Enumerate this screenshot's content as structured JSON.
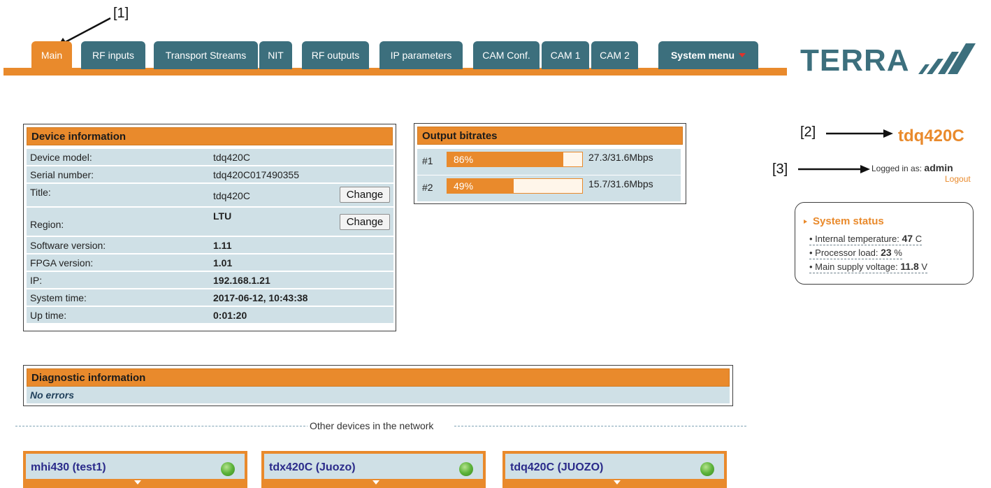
{
  "annotations": [
    "[1]",
    "[2]",
    "[3]"
  ],
  "tabs": [
    {
      "label": "Main",
      "active": true
    },
    {
      "label": "RF inputs",
      "active": false
    },
    {
      "label": "Transport Streams",
      "active": false
    },
    {
      "label": "NIT",
      "active": false
    },
    {
      "label": "RF outputs",
      "active": false
    },
    {
      "label": "IP parameters",
      "active": false
    },
    {
      "label": "CAM Conf.",
      "active": false
    },
    {
      "label": "CAM 1",
      "active": false
    },
    {
      "label": "CAM 2",
      "active": false
    },
    {
      "label": "System menu",
      "active": false
    }
  ],
  "logo": "TERRA",
  "device_info": {
    "title": "Device information",
    "rows": [
      {
        "label": "Device model:",
        "value": "tdq420C"
      },
      {
        "label": "Serial number:",
        "value": "tdq420C017490355"
      },
      {
        "label": "Title:",
        "value": "tdq420C",
        "button": "Change"
      },
      {
        "label": "Region:",
        "value": "LTU",
        "button": "Change"
      },
      {
        "label": "Software version:",
        "value": "1.11"
      },
      {
        "label": "FPGA version:",
        "value": "1.01"
      },
      {
        "label": "IP:",
        "value": "192.168.1.21"
      },
      {
        "label": "System time:",
        "value": "2017-06-12, 10:43:38"
      },
      {
        "label": "Up time:",
        "value": "0:01:20"
      }
    ]
  },
  "output_bitrates": {
    "title": "Output bitrates",
    "rows": [
      {
        "label": "#1",
        "percent": 86,
        "percent_label": "86%",
        "value": "27.3/31.6Mbps"
      },
      {
        "label": "#2",
        "percent": 49,
        "percent_label": "49%",
        "value": "15.7/31.6Mbps"
      }
    ]
  },
  "device_name": "tdq420C",
  "login": {
    "prefix": "Logged in as:",
    "user": "admin",
    "logout": "Logout"
  },
  "system_status": {
    "title": "System status",
    "items": [
      {
        "label": "Internal temperature:",
        "value": "47",
        "unit": "C"
      },
      {
        "label": "Processor load:",
        "value": "23",
        "unit": "%"
      },
      {
        "label": "Main supply voltage:",
        "value": "11.8",
        "unit": "V"
      }
    ]
  },
  "diagnostic": {
    "title": "Diagnostic information",
    "message": "No errors"
  },
  "network": {
    "separator": "Other devices in the network",
    "devices": [
      "mhi430 (test1)",
      "tdx420C (Juozo)",
      "tdq420C (JUOZO)"
    ]
  },
  "colors": {
    "accent": "#e98a2c",
    "tab": "#3c6f7d",
    "row": "#cfe0e6"
  }
}
